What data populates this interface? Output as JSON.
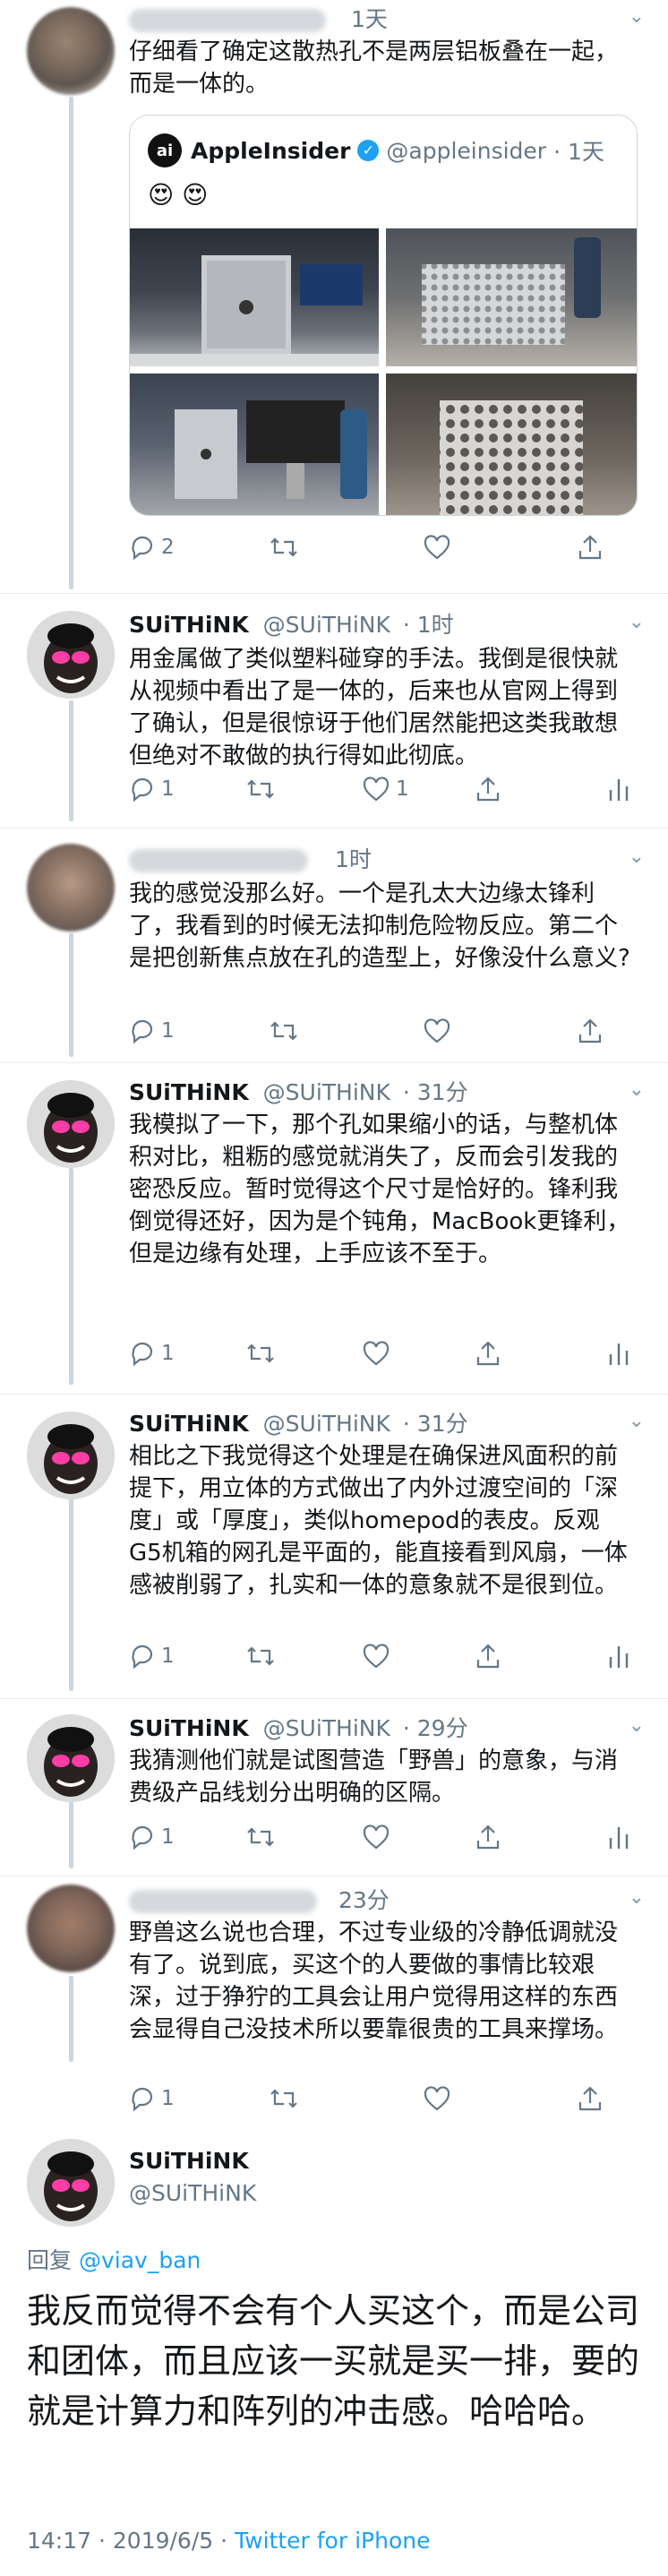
{
  "tweets": [
    {
      "time": "1天",
      "text": "仔细看了确定这散热孔不是两层铝板叠在一起，而是一体的。",
      "quote": {
        "logo": "ai",
        "name": "AppleInsider",
        "handle": "@appleinsider",
        "time": "· 1天",
        "emoji": "😍 😍"
      },
      "replies": "2"
    },
    {
      "name": "SUiTHiNK",
      "handle": "@SUiTHiNK",
      "time": "· 1时",
      "text": "用金属做了类似塑料碰穿的手法。我倒是很快就从视频中看出了是一体的，后来也从官网上得到了确认，但是很惊讶于他们居然能把这类我敢想但绝对不敢做的执行得如此彻底。",
      "replies": "1",
      "likes": "1"
    },
    {
      "time": "1时",
      "text": "我的感觉没那么好。一个是孔太大边缘太锋利了，我看到的时候无法抑制危险物反应。第二个是把创新焦点放在孔的造型上，好像没什么意义?",
      "replies": "1"
    },
    {
      "name": "SUiTHiNK",
      "handle": "@SUiTHiNK",
      "time": "· 31分",
      "text": "我模拟了一下，那个孔如果缩小的话，与整机体积对比，粗粝的感觉就消失了，反而会引发我的密恐反应。暂时觉得这个尺寸是恰好的。锋利我倒觉得还好，因为是个钝角，MacBook更锋利，但是边缘有处理，上手应该不至于。",
      "replies": "1"
    },
    {
      "name": "SUiTHiNK",
      "handle": "@SUiTHiNK",
      "time": "· 31分",
      "text": "相比之下我觉得这个处理是在确保进风面积的前提下，用立体的方式做出了内外过渡空间的「深度」或「厚度」，类似homepod的表皮。反观G5机箱的网孔是平面的，能直接看到风扇，一体感被削弱了，扎实和一体的意象就不是很到位。",
      "replies": "1"
    },
    {
      "name": "SUiTHiNK",
      "handle": "@SUiTHiNK",
      "time": "· 29分",
      "text": "我猜测他们就是试图营造「野兽」的意象，与消费级产品线划分出明确的区隔。",
      "replies": "1"
    },
    {
      "time": "23分",
      "text": "野兽这么说也合理，不过专业级的冷静低调就没有了。说到底，买这个的人要做的事情比较艰深，过于狰狞的工具会让用户觉得用这样的东西会显得自己没技术所以要靠很贵的工具来撑场。",
      "replies": "1"
    }
  ],
  "main_tweet": {
    "name": "SUiTHiNK",
    "handle": "@SUiTHiNK",
    "reply_prefix": "回复",
    "reply_to": "@viav_ban",
    "text": "我反而觉得不会有个人买这个，而是公司和团体，而且应该一买就是买一排，要的就是计算力和阵列的冲击感。哈哈哈。",
    "time": "14:17 · 2019/6/5 · ",
    "source": "Twitter for iPhone"
  },
  "icons": {
    "reply": "reply-icon",
    "retweet": "retweet-icon",
    "like": "heart-icon",
    "share": "share-icon",
    "analytics": "analytics-icon",
    "more": "chevron-down-icon"
  },
  "colors": {
    "link": "#1da1f2",
    "secondary": "#657786",
    "thread_line": "#ccd6dd"
  }
}
